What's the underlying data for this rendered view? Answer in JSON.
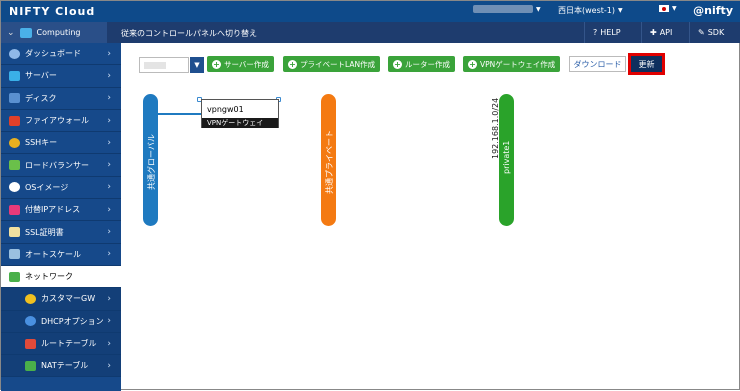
{
  "topbar": {
    "logo": "NIFTY Cloud",
    "region": "西日本(west-1)",
    "brand": "@nifty"
  },
  "subbar": {
    "service": "Computing",
    "switch_link": "従来のコントロールパネルへ切り替え",
    "help": "HELP",
    "api": "API",
    "sdk": "SDK"
  },
  "sidebar": {
    "items": [
      {
        "label": "ダッシュボード",
        "icon": "dashboard-icon"
      },
      {
        "label": "サーバー",
        "icon": "server-icon"
      },
      {
        "label": "ディスク",
        "icon": "disk-icon"
      },
      {
        "label": "ファイアウォール",
        "icon": "firewall-icon"
      },
      {
        "label": "SSHキー",
        "icon": "key-icon"
      },
      {
        "label": "ロードバランサー",
        "icon": "load-balancer-icon"
      },
      {
        "label": "OSイメージ",
        "icon": "os-image-icon"
      },
      {
        "label": "付替IPアドレス",
        "icon": "ip-icon"
      },
      {
        "label": "SSL証明書",
        "icon": "certificate-icon"
      },
      {
        "label": "オートスケール",
        "icon": "autoscale-icon"
      },
      {
        "label": "ネットワーク",
        "icon": "network-icon"
      },
      {
        "label": "カスタマーGW",
        "icon": "customer-gw-icon"
      },
      {
        "label": "DHCPオプション",
        "icon": "dhcp-icon"
      },
      {
        "label": "ルートテーブル",
        "icon": "route-table-icon"
      },
      {
        "label": "NATテーブル",
        "icon": "nat-table-icon"
      }
    ]
  },
  "toolbar": {
    "create_server": "サーバー作成",
    "create_private_lan": "プライベートLAN作成",
    "create_router": "ルーター作成",
    "create_vpn_gateway": "VPNゲートウェイ作成",
    "download": "ダウンロード",
    "refresh": "更新"
  },
  "diagram": {
    "networks": [
      {
        "label": "共通グローバル",
        "color": "#1f7ac0"
      },
      {
        "label": "共通プライベート",
        "color": "#f47a12"
      },
      {
        "label": "private1",
        "cidr": "192.168.1.0/24",
        "color": "#2aa32a"
      }
    ],
    "vpn_gateway": {
      "name": "vpngw01",
      "type": "VPNゲートウェイ"
    }
  },
  "colors": {
    "topbar": "#0e4a8a",
    "sidebar": "#16498a",
    "green_button": "#3aa33a",
    "highlight": "#e00000"
  }
}
